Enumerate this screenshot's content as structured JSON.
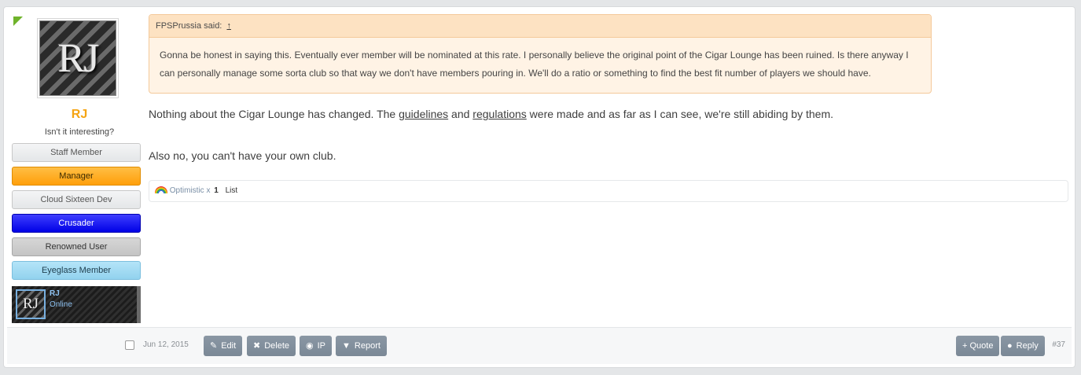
{
  "user": {
    "name": "RJ",
    "title": "Isn't it interesting?",
    "avatar_initials": "RJ",
    "banners": [
      "Staff Member",
      "Manager",
      "Cloud Sixteen Dev",
      "Crusader",
      "Renowned User",
      "Eyeglass Member"
    ],
    "mini_card": {
      "name": "RJ",
      "status": "Online",
      "initials": "RJ"
    }
  },
  "quote": {
    "author_said": "FPSPrussia said:",
    "jump": "↑",
    "text": "Gonna be honest in saying this. Eventually ever member will be nominated at this rate. I personally believe the original point of the Cigar Lounge has been ruined. Is there anyway I can personally manage some sorta club so that way we don't have members pouring in. We'll do a ratio or something to find the best fit number of players we should have."
  },
  "message": {
    "p1_pre": "Nothing about the Cigar Lounge has changed. The ",
    "link1": "guidelines",
    "p1_mid": " and ",
    "link2": "regulations",
    "p1_post": " were made and as far as I can see, we're still abiding by them.",
    "p2": "Also no, you can't have your own club."
  },
  "ratings": {
    "label": "Optimistic x",
    "count": "1",
    "list": "List",
    "icon": "rainbow-icon"
  },
  "footer": {
    "date": "Jun 12, 2015",
    "buttons": {
      "edit": "Edit",
      "delete": "Delete",
      "ip": "IP",
      "report": "Report",
      "quote": "+ Quote",
      "reply": "Reply"
    },
    "post_number": "#37"
  },
  "colors": {
    "username": "#f5a413",
    "manager": "#ffae22",
    "crusader": "#1a1aff",
    "eyeglass": "#a2dbf3",
    "buttons": "#8392a0"
  }
}
